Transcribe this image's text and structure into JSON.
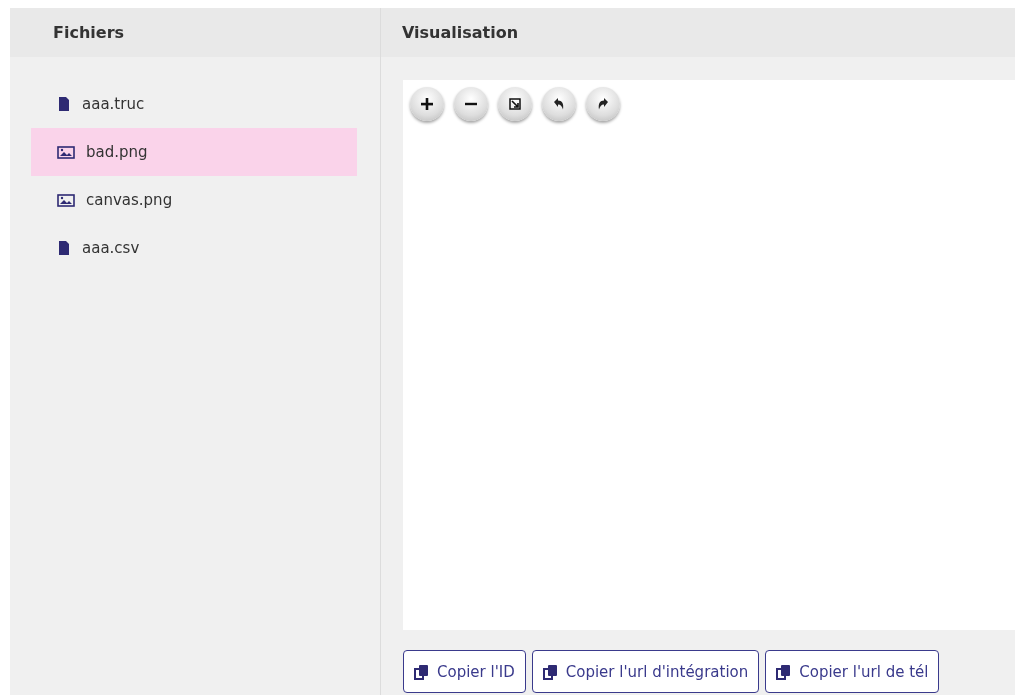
{
  "files_panel": {
    "title": "Fichiers",
    "items": [
      {
        "name": "aaa.truc",
        "kind": "document",
        "selected": false
      },
      {
        "name": "bad.png",
        "kind": "image",
        "selected": true
      },
      {
        "name": "canvas.png",
        "kind": "image",
        "selected": false
      },
      {
        "name": "aaa.csv",
        "kind": "document",
        "selected": false
      }
    ]
  },
  "preview_panel": {
    "title": "Visualisation",
    "viewer_tools": [
      {
        "kind": "zoom-in"
      },
      {
        "kind": "zoom-out"
      },
      {
        "kind": "fit"
      },
      {
        "kind": "rotate-left"
      },
      {
        "kind": "rotate-right"
      }
    ],
    "buttons": [
      {
        "label": "Copier l'ID"
      },
      {
        "label": "Copier l'url d'intégration"
      },
      {
        "label": "Copier l'url de tél"
      }
    ]
  }
}
